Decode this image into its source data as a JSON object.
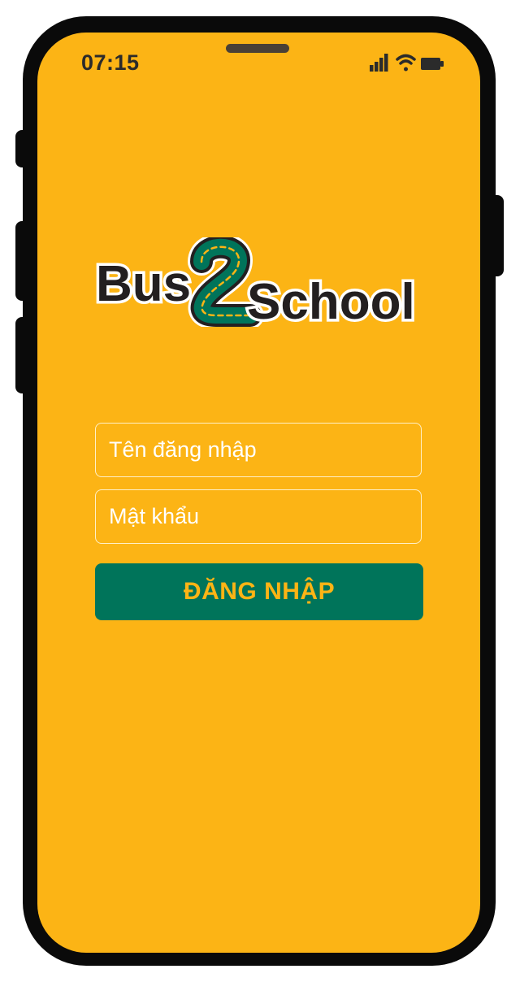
{
  "status_bar": {
    "time": "07:15",
    "icons": [
      "signal-icon",
      "wifi-icon",
      "battery-icon"
    ]
  },
  "logo": {
    "text_part1": "Bus",
    "text_part2": "School",
    "colors": {
      "text": "#231f20",
      "road": "#00745a",
      "dashes": "#fcb415"
    }
  },
  "form": {
    "username_placeholder": "Tên đăng nhập",
    "password_placeholder": "Mật khẩu",
    "login_label": "ĐĂNG NHẬP"
  },
  "colors": {
    "background": "#fcb415",
    "button": "#00745a",
    "button_text": "#fcb415",
    "frame": "#0a0a0a"
  }
}
